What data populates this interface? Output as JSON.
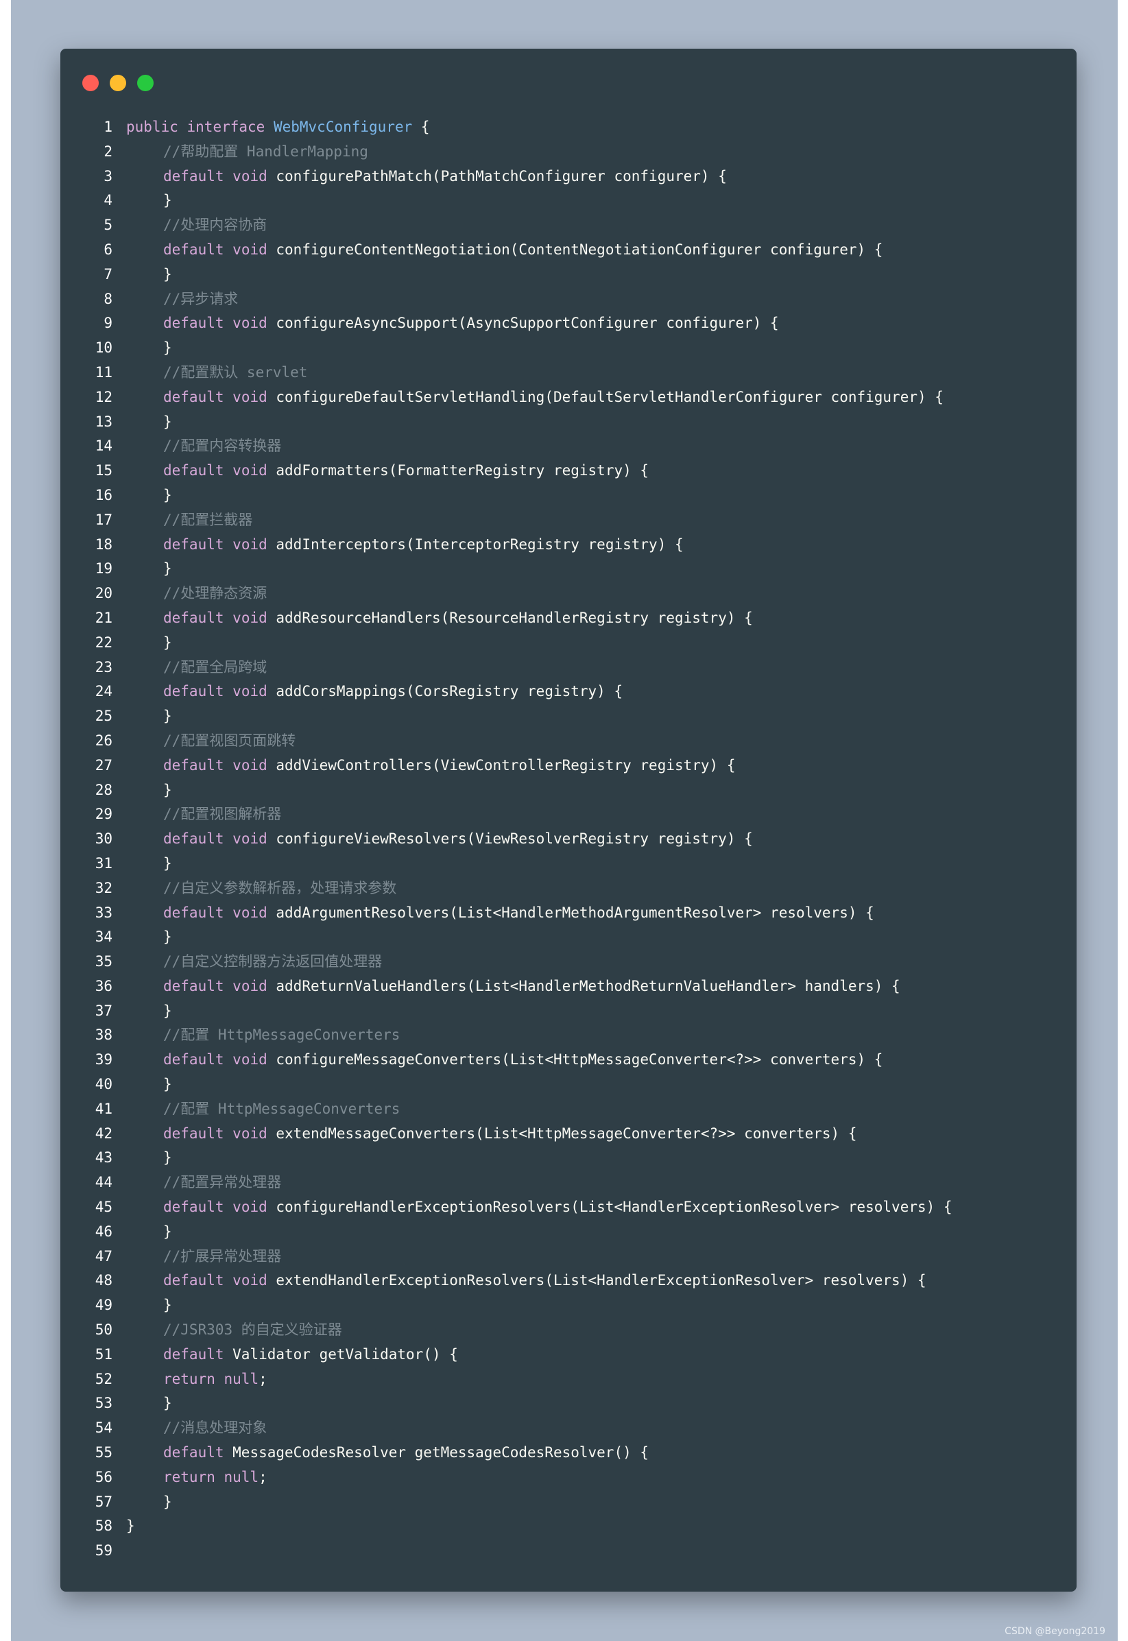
{
  "window": {
    "buttons": [
      {
        "name": "close",
        "color": "#ff5f56"
      },
      {
        "name": "minimize",
        "color": "#ffbd2e"
      },
      {
        "name": "maximize",
        "color": "#27c93f"
      }
    ]
  },
  "code_lines": [
    [
      {
        "t": "public",
        "c": "kw"
      },
      {
        "t": " "
      },
      {
        "t": "interface",
        "c": "kw"
      },
      {
        "t": " "
      },
      {
        "t": "WebMvcConfigurer",
        "c": "cls"
      },
      {
        "t": " {"
      }
    ],
    [
      {
        "t": "IND"
      },
      {
        "t": "//帮助配置 HandlerMapping",
        "c": "cm"
      }
    ],
    [
      {
        "t": "IND"
      },
      {
        "t": "default",
        "c": "kw"
      },
      {
        "t": " "
      },
      {
        "t": "void",
        "c": "kw"
      },
      {
        "t": " configurePathMatch(PathMatchConfigurer configurer) {"
      }
    ],
    [
      {
        "t": "IND"
      },
      {
        "t": "}"
      }
    ],
    [
      {
        "t": "IND"
      },
      {
        "t": "//处理内容协商",
        "c": "cm"
      }
    ],
    [
      {
        "t": "IND"
      },
      {
        "t": "default",
        "c": "kw"
      },
      {
        "t": " "
      },
      {
        "t": "void",
        "c": "kw"
      },
      {
        "t": " configureContentNegotiation(ContentNegotiationConfigurer configurer) {"
      }
    ],
    [
      {
        "t": "IND"
      },
      {
        "t": "}"
      }
    ],
    [
      {
        "t": "IND"
      },
      {
        "t": "//异步请求",
        "c": "cm"
      }
    ],
    [
      {
        "t": "IND"
      },
      {
        "t": "default",
        "c": "kw"
      },
      {
        "t": " "
      },
      {
        "t": "void",
        "c": "kw"
      },
      {
        "t": " configureAsyncSupport(AsyncSupportConfigurer configurer) {"
      }
    ],
    [
      {
        "t": "IND"
      },
      {
        "t": "}"
      }
    ],
    [
      {
        "t": "IND"
      },
      {
        "t": "//配置默认 servlet",
        "c": "cm"
      }
    ],
    [
      {
        "t": "IND"
      },
      {
        "t": "default",
        "c": "kw"
      },
      {
        "t": " "
      },
      {
        "t": "void",
        "c": "kw"
      },
      {
        "t": " configureDefaultServletHandling(DefaultServletHandlerConfigurer configurer) {"
      }
    ],
    [
      {
        "t": "IND"
      },
      {
        "t": "}"
      }
    ],
    [
      {
        "t": "IND"
      },
      {
        "t": "//配置内容转换器",
        "c": "cm"
      }
    ],
    [
      {
        "t": "IND"
      },
      {
        "t": "default",
        "c": "kw"
      },
      {
        "t": " "
      },
      {
        "t": "void",
        "c": "kw"
      },
      {
        "t": " addFormatters(FormatterRegistry registry) {"
      }
    ],
    [
      {
        "t": "IND"
      },
      {
        "t": "}"
      }
    ],
    [
      {
        "t": "IND"
      },
      {
        "t": "//配置拦截器",
        "c": "cm"
      }
    ],
    [
      {
        "t": "IND"
      },
      {
        "t": "default",
        "c": "kw"
      },
      {
        "t": " "
      },
      {
        "t": "void",
        "c": "kw"
      },
      {
        "t": " addInterceptors(InterceptorRegistry registry) {"
      }
    ],
    [
      {
        "t": "IND"
      },
      {
        "t": "}"
      }
    ],
    [
      {
        "t": "IND"
      },
      {
        "t": "//处理静态资源",
        "c": "cm"
      }
    ],
    [
      {
        "t": "IND"
      },
      {
        "t": "default",
        "c": "kw"
      },
      {
        "t": " "
      },
      {
        "t": "void",
        "c": "kw"
      },
      {
        "t": " addResourceHandlers(ResourceHandlerRegistry registry) {"
      }
    ],
    [
      {
        "t": "IND"
      },
      {
        "t": "}"
      }
    ],
    [
      {
        "t": "IND"
      },
      {
        "t": "//配置全局跨域",
        "c": "cm"
      }
    ],
    [
      {
        "t": "IND"
      },
      {
        "t": "default",
        "c": "kw"
      },
      {
        "t": " "
      },
      {
        "t": "void",
        "c": "kw"
      },
      {
        "t": " addCorsMappings(CorsRegistry registry) {"
      }
    ],
    [
      {
        "t": "IND"
      },
      {
        "t": "}"
      }
    ],
    [
      {
        "t": "IND"
      },
      {
        "t": "//配置视图页面跳转",
        "c": "cm"
      }
    ],
    [
      {
        "t": "IND"
      },
      {
        "t": "default",
        "c": "kw"
      },
      {
        "t": " "
      },
      {
        "t": "void",
        "c": "kw"
      },
      {
        "t": " addViewControllers(ViewControllerRegistry registry) {"
      }
    ],
    [
      {
        "t": "IND"
      },
      {
        "t": "}"
      }
    ],
    [
      {
        "t": "IND"
      },
      {
        "t": "//配置视图解析器",
        "c": "cm"
      }
    ],
    [
      {
        "t": "IND"
      },
      {
        "t": "default",
        "c": "kw"
      },
      {
        "t": " "
      },
      {
        "t": "void",
        "c": "kw"
      },
      {
        "t": " configureViewResolvers(ViewResolverRegistry registry) {"
      }
    ],
    [
      {
        "t": "IND"
      },
      {
        "t": "}"
      }
    ],
    [
      {
        "t": "IND"
      },
      {
        "t": "//自定义参数解析器，处理请求参数",
        "c": "cm"
      }
    ],
    [
      {
        "t": "IND"
      },
      {
        "t": "default",
        "c": "kw"
      },
      {
        "t": " "
      },
      {
        "t": "void",
        "c": "kw"
      },
      {
        "t": " addArgumentResolvers(List<HandlerMethodArgumentResolver> resolvers) {"
      }
    ],
    [
      {
        "t": "IND"
      },
      {
        "t": "}"
      }
    ],
    [
      {
        "t": "IND"
      },
      {
        "t": "//自定义控制器方法返回值处理器",
        "c": "cm"
      }
    ],
    [
      {
        "t": "IND"
      },
      {
        "t": "default",
        "c": "kw"
      },
      {
        "t": " "
      },
      {
        "t": "void",
        "c": "kw"
      },
      {
        "t": " addReturnValueHandlers(List<HandlerMethodReturnValueHandler> handlers) {"
      }
    ],
    [
      {
        "t": "IND"
      },
      {
        "t": "}"
      }
    ],
    [
      {
        "t": "IND"
      },
      {
        "t": "//配置 HttpMessageConverters",
        "c": "cm"
      }
    ],
    [
      {
        "t": "IND"
      },
      {
        "t": "default",
        "c": "kw"
      },
      {
        "t": " "
      },
      {
        "t": "void",
        "c": "kw"
      },
      {
        "t": " configureMessageConverters(List<HttpMessageConverter<?>> converters) {"
      }
    ],
    [
      {
        "t": "IND"
      },
      {
        "t": "}"
      }
    ],
    [
      {
        "t": "IND"
      },
      {
        "t": "//配置 HttpMessageConverters",
        "c": "cm"
      }
    ],
    [
      {
        "t": "IND"
      },
      {
        "t": "default",
        "c": "kw"
      },
      {
        "t": " "
      },
      {
        "t": "void",
        "c": "kw"
      },
      {
        "t": " extendMessageConverters(List<HttpMessageConverter<?>> converters) {"
      }
    ],
    [
      {
        "t": "IND"
      },
      {
        "t": "}"
      }
    ],
    [
      {
        "t": "IND"
      },
      {
        "t": "//配置异常处理器",
        "c": "cm"
      }
    ],
    [
      {
        "t": "IND"
      },
      {
        "t": "default",
        "c": "kw"
      },
      {
        "t": " "
      },
      {
        "t": "void",
        "c": "kw"
      },
      {
        "t": " configureHandlerExceptionResolvers(List<HandlerExceptionResolver> resolvers) {"
      }
    ],
    [
      {
        "t": "IND"
      },
      {
        "t": "}"
      }
    ],
    [
      {
        "t": "IND"
      },
      {
        "t": "//扩展异常处理器",
        "c": "cm"
      }
    ],
    [
      {
        "t": "IND"
      },
      {
        "t": "default",
        "c": "kw"
      },
      {
        "t": " "
      },
      {
        "t": "void",
        "c": "kw"
      },
      {
        "t": " extendHandlerExceptionResolvers(List<HandlerExceptionResolver> resolvers) {"
      }
    ],
    [
      {
        "t": "IND"
      },
      {
        "t": "}"
      }
    ],
    [
      {
        "t": "IND"
      },
      {
        "t": "//JSR303 的自定义验证器",
        "c": "cm"
      }
    ],
    [
      {
        "t": "IND"
      },
      {
        "t": "default",
        "c": "kw"
      },
      {
        "t": " Validator getValidator() {"
      }
    ],
    [
      {
        "t": "IND"
      },
      {
        "t": "return",
        "c": "kw"
      },
      {
        "t": " "
      },
      {
        "t": "null",
        "c": "kw"
      },
      {
        "t": ";"
      }
    ],
    [
      {
        "t": "IND"
      },
      {
        "t": "}"
      }
    ],
    [
      {
        "t": "IND"
      },
      {
        "t": "//消息处理对象",
        "c": "cm"
      }
    ],
    [
      {
        "t": "IND"
      },
      {
        "t": "default",
        "c": "kw"
      },
      {
        "t": " MessageCodesResolver getMessageCodesResolver() {"
      }
    ],
    [
      {
        "t": "IND"
      },
      {
        "t": "return",
        "c": "kw"
      },
      {
        "t": " "
      },
      {
        "t": "null",
        "c": "kw"
      },
      {
        "t": ";"
      }
    ],
    [
      {
        "t": "IND"
      },
      {
        "t": "}"
      }
    ],
    [
      {
        "t": "}"
      }
    ],
    []
  ],
  "watermark": "CSDN @Beyong2019"
}
